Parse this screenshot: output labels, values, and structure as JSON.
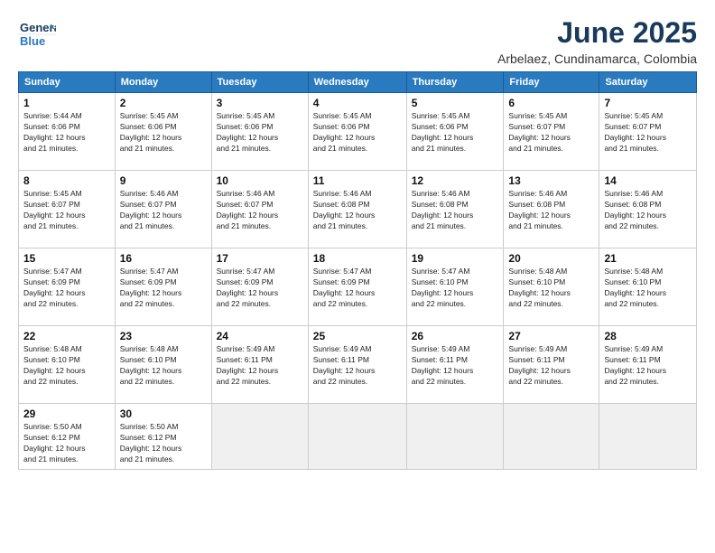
{
  "header": {
    "logo_line1": "General",
    "logo_line2": "Blue",
    "month_year": "June 2025",
    "location": "Arbelaez, Cundinamarca, Colombia"
  },
  "weekdays": [
    "Sunday",
    "Monday",
    "Tuesday",
    "Wednesday",
    "Thursday",
    "Friday",
    "Saturday"
  ],
  "weeks": [
    [
      {
        "day": "1",
        "detail": "Sunrise: 5:44 AM\nSunset: 6:06 PM\nDaylight: 12 hours\nand 21 minutes."
      },
      {
        "day": "2",
        "detail": "Sunrise: 5:45 AM\nSunset: 6:06 PM\nDaylight: 12 hours\nand 21 minutes."
      },
      {
        "day": "3",
        "detail": "Sunrise: 5:45 AM\nSunset: 6:06 PM\nDaylight: 12 hours\nand 21 minutes."
      },
      {
        "day": "4",
        "detail": "Sunrise: 5:45 AM\nSunset: 6:06 PM\nDaylight: 12 hours\nand 21 minutes."
      },
      {
        "day": "5",
        "detail": "Sunrise: 5:45 AM\nSunset: 6:06 PM\nDaylight: 12 hours\nand 21 minutes."
      },
      {
        "day": "6",
        "detail": "Sunrise: 5:45 AM\nSunset: 6:07 PM\nDaylight: 12 hours\nand 21 minutes."
      },
      {
        "day": "7",
        "detail": "Sunrise: 5:45 AM\nSunset: 6:07 PM\nDaylight: 12 hours\nand 21 minutes."
      }
    ],
    [
      {
        "day": "8",
        "detail": "Sunrise: 5:45 AM\nSunset: 6:07 PM\nDaylight: 12 hours\nand 21 minutes."
      },
      {
        "day": "9",
        "detail": "Sunrise: 5:46 AM\nSunset: 6:07 PM\nDaylight: 12 hours\nand 21 minutes."
      },
      {
        "day": "10",
        "detail": "Sunrise: 5:46 AM\nSunset: 6:07 PM\nDaylight: 12 hours\nand 21 minutes."
      },
      {
        "day": "11",
        "detail": "Sunrise: 5:46 AM\nSunset: 6:08 PM\nDaylight: 12 hours\nand 21 minutes."
      },
      {
        "day": "12",
        "detail": "Sunrise: 5:46 AM\nSunset: 6:08 PM\nDaylight: 12 hours\nand 21 minutes."
      },
      {
        "day": "13",
        "detail": "Sunrise: 5:46 AM\nSunset: 6:08 PM\nDaylight: 12 hours\nand 21 minutes."
      },
      {
        "day": "14",
        "detail": "Sunrise: 5:46 AM\nSunset: 6:08 PM\nDaylight: 12 hours\nand 22 minutes."
      }
    ],
    [
      {
        "day": "15",
        "detail": "Sunrise: 5:47 AM\nSunset: 6:09 PM\nDaylight: 12 hours\nand 22 minutes."
      },
      {
        "day": "16",
        "detail": "Sunrise: 5:47 AM\nSunset: 6:09 PM\nDaylight: 12 hours\nand 22 minutes."
      },
      {
        "day": "17",
        "detail": "Sunrise: 5:47 AM\nSunset: 6:09 PM\nDaylight: 12 hours\nand 22 minutes."
      },
      {
        "day": "18",
        "detail": "Sunrise: 5:47 AM\nSunset: 6:09 PM\nDaylight: 12 hours\nand 22 minutes."
      },
      {
        "day": "19",
        "detail": "Sunrise: 5:47 AM\nSunset: 6:10 PM\nDaylight: 12 hours\nand 22 minutes."
      },
      {
        "day": "20",
        "detail": "Sunrise: 5:48 AM\nSunset: 6:10 PM\nDaylight: 12 hours\nand 22 minutes."
      },
      {
        "day": "21",
        "detail": "Sunrise: 5:48 AM\nSunset: 6:10 PM\nDaylight: 12 hours\nand 22 minutes."
      }
    ],
    [
      {
        "day": "22",
        "detail": "Sunrise: 5:48 AM\nSunset: 6:10 PM\nDaylight: 12 hours\nand 22 minutes."
      },
      {
        "day": "23",
        "detail": "Sunrise: 5:48 AM\nSunset: 6:10 PM\nDaylight: 12 hours\nand 22 minutes."
      },
      {
        "day": "24",
        "detail": "Sunrise: 5:49 AM\nSunset: 6:11 PM\nDaylight: 12 hours\nand 22 minutes."
      },
      {
        "day": "25",
        "detail": "Sunrise: 5:49 AM\nSunset: 6:11 PM\nDaylight: 12 hours\nand 22 minutes."
      },
      {
        "day": "26",
        "detail": "Sunrise: 5:49 AM\nSunset: 6:11 PM\nDaylight: 12 hours\nand 22 minutes."
      },
      {
        "day": "27",
        "detail": "Sunrise: 5:49 AM\nSunset: 6:11 PM\nDaylight: 12 hours\nand 22 minutes."
      },
      {
        "day": "28",
        "detail": "Sunrise: 5:49 AM\nSunset: 6:11 PM\nDaylight: 12 hours\nand 22 minutes."
      }
    ],
    [
      {
        "day": "29",
        "detail": "Sunrise: 5:50 AM\nSunset: 6:12 PM\nDaylight: 12 hours\nand 21 minutes."
      },
      {
        "day": "30",
        "detail": "Sunrise: 5:50 AM\nSunset: 6:12 PM\nDaylight: 12 hours\nand 21 minutes."
      },
      {
        "day": "",
        "detail": ""
      },
      {
        "day": "",
        "detail": ""
      },
      {
        "day": "",
        "detail": ""
      },
      {
        "day": "",
        "detail": ""
      },
      {
        "day": "",
        "detail": ""
      }
    ]
  ]
}
